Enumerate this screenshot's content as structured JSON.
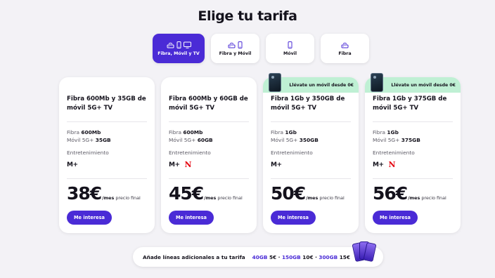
{
  "page_title": "Elige tu tarifa",
  "tabs": [
    {
      "label": "Fibra, Móvil y TV",
      "icons": [
        "router-icon",
        "phone-icon",
        "tv-icon"
      ],
      "active": true
    },
    {
      "label": "Fibra y Móvil",
      "icons": [
        "router-icon",
        "phone-icon"
      ],
      "active": false
    },
    {
      "label": "Móvil",
      "icons": [
        "phone-icon"
      ],
      "active": false
    },
    {
      "label": "Fibra",
      "icons": [
        "router-icon"
      ],
      "active": false
    }
  ],
  "cards": [
    {
      "title": "Fibra 600Mb y 35GB de móvil 5G+ TV",
      "promo": "",
      "fibra_label": "Fibra ",
      "fibra_value": "600Mb",
      "movil_label": "Móvil 5G+ ",
      "movil_value": "35GB",
      "entertainment_label": "Entretenimiento",
      "logos": [
        "movistar-plus"
      ],
      "price": "38€",
      "per": "/mes",
      "price_note": "precio final",
      "cta": "Me interesa"
    },
    {
      "title": "Fibra 600Mb y 60GB de móvil 5G+ TV",
      "promo": "",
      "fibra_label": "Fibra ",
      "fibra_value": "600Mb",
      "movil_label": "Móvil 5G+ ",
      "movil_value": "60GB",
      "entertainment_label": "Entretenimiento",
      "logos": [
        "movistar-plus",
        "netflix"
      ],
      "price": "45€",
      "per": "/mes",
      "price_note": "precio final",
      "cta": "Me interesa"
    },
    {
      "title": "Fibra 1Gb y 350GB de móvil 5G+ TV",
      "promo": "Llévate un móvil desde 0€",
      "fibra_label": "Fibra ",
      "fibra_value": "1Gb",
      "movil_label": "Móvil 5G+ ",
      "movil_value": "350GB",
      "entertainment_label": "Entretenimiento",
      "logos": [
        "movistar-plus"
      ],
      "price": "50€",
      "per": "/mes",
      "price_note": "precio final",
      "cta": "Me interesa"
    },
    {
      "title": "Fibra 1Gb y 375GB de móvil 5G+ TV",
      "promo": "Llévate un móvil desde 0€",
      "fibra_label": "Fibra ",
      "fibra_value": "1Gb",
      "movil_label": "Móvil 5G+ ",
      "movil_value": "375GB",
      "entertainment_label": "Entretenimiento",
      "logos": [
        "movistar-plus",
        "netflix"
      ],
      "price": "56€",
      "per": "/mes",
      "price_note": "precio final",
      "cta": "Me interesa"
    }
  ],
  "logo_text": {
    "movistar": "M+",
    "netflix": "N"
  },
  "addon": {
    "lead": "Añade líneas adicionales a tu tarifa",
    "offers": [
      {
        "gb": "40GB",
        "price": "5€"
      },
      {
        "gb": "150GB",
        "price": "10€"
      },
      {
        "gb": "300GB",
        "price": "15€"
      }
    ],
    "separator": " · "
  },
  "colors": {
    "accent": "#4a2bd6",
    "promo_banner": "#bff0d4",
    "netflix": "#e50914",
    "background": "#f3f2f6"
  }
}
